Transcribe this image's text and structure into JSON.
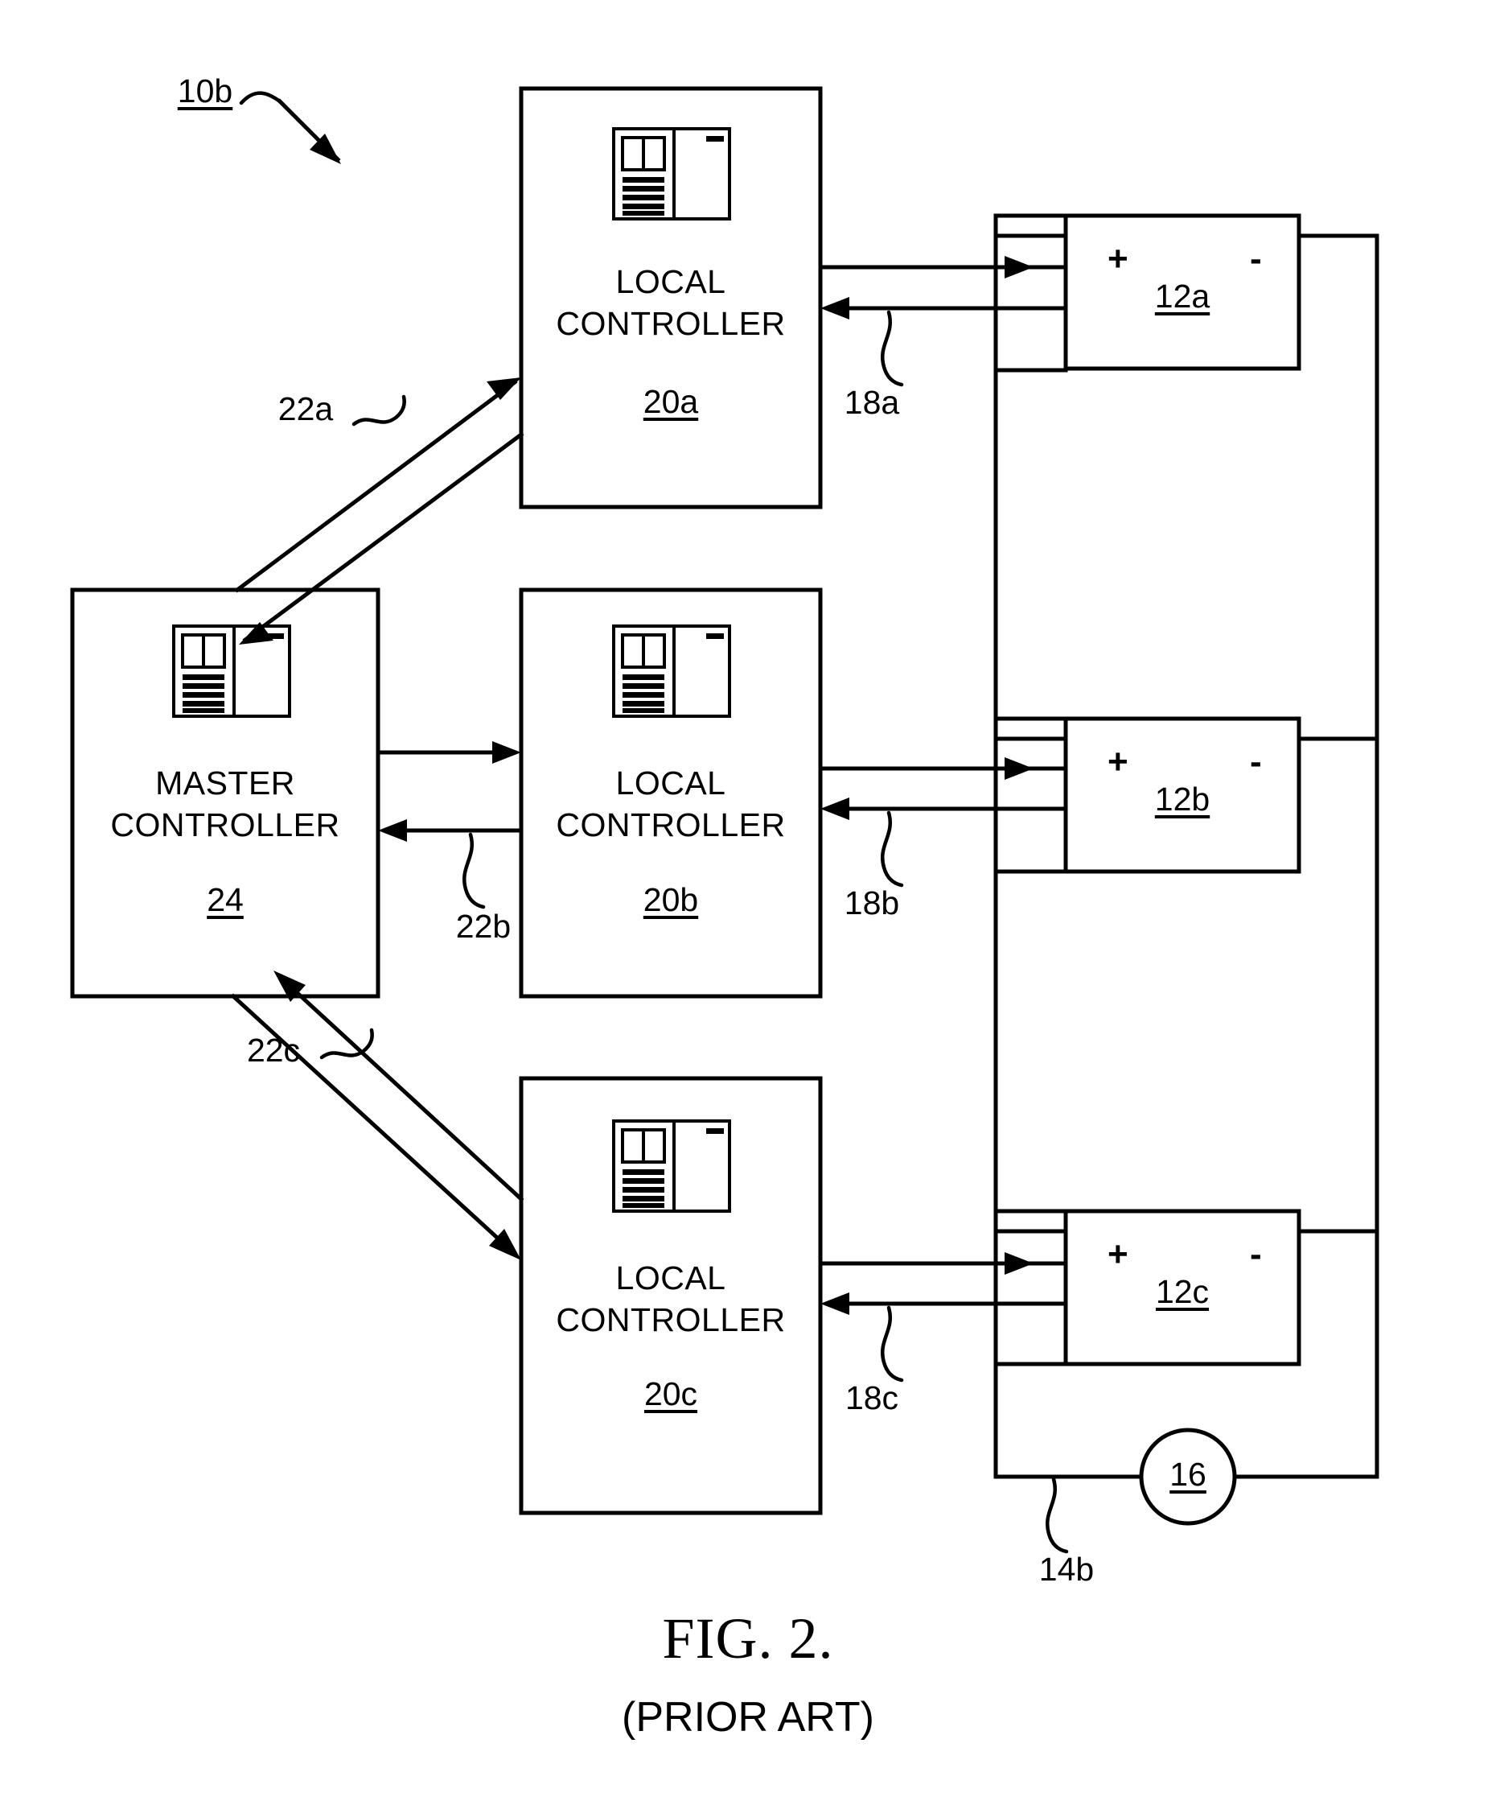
{
  "figure": {
    "system_ref": "10b",
    "title": "FIG. 2.",
    "subtitle": "(PRIOR ART)"
  },
  "blocks": {
    "master_controller": {
      "line1": "MASTER",
      "line2": "CONTROLLER",
      "ref": "24",
      "icon": "controller-cabinet-icon"
    },
    "local_controllers": [
      {
        "line1": "LOCAL",
        "line2": "CONTROLLER",
        "ref": "20a",
        "icon": "controller-cabinet-icon"
      },
      {
        "line1": "LOCAL",
        "line2": "CONTROLLER",
        "ref": "20b",
        "icon": "controller-cabinet-icon"
      },
      {
        "line1": "LOCAL",
        "line2": "CONTROLLER",
        "ref": "20c",
        "icon": "controller-cabinet-icon"
      }
    ],
    "batteries": [
      {
        "ref": "12a",
        "positive": "+",
        "negative": "-"
      },
      {
        "ref": "12b",
        "positive": "+",
        "negative": "-"
      },
      {
        "ref": "12c",
        "positive": "+",
        "negative": "-"
      }
    ],
    "load": {
      "ref": "16",
      "shape": "circle"
    }
  },
  "connection_labels": {
    "controller_to_battery": [
      "18a",
      "18b",
      "18c"
    ],
    "master_to_local": [
      "22a",
      "22b",
      "22c"
    ],
    "power_bus": "14b"
  }
}
